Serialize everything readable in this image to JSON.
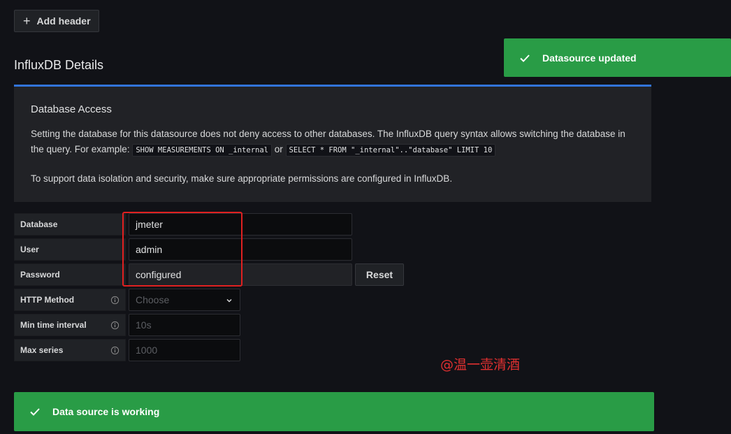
{
  "toolbar": {
    "add_header_label": "Add header"
  },
  "toast": {
    "message": "Datasource updated",
    "color": "#299c46"
  },
  "section": {
    "title": "InfluxDB Details"
  },
  "info": {
    "heading": "Database Access",
    "text_part1": "Setting the database for this datasource does not deny access to other databases. The InfluxDB query syntax allows switching the database in the query. For example: ",
    "code1": "SHOW MEASUREMENTS ON _internal",
    "text_or": " or ",
    "code2": "SELECT * FROM \"_internal\"..\"database\" LIMIT 10",
    "text_part2": "To support data isolation and security, make sure appropriate permissions are configured in InfluxDB.",
    "accent_color": "#3274d9"
  },
  "form": {
    "database": {
      "label": "Database",
      "value": "jmeter"
    },
    "user": {
      "label": "User",
      "value": "admin"
    },
    "password": {
      "label": "Password",
      "value": "configured",
      "reset_label": "Reset"
    },
    "http_method": {
      "label": "HTTP Method",
      "placeholder": "Choose"
    },
    "min_time_interval": {
      "label": "Min time interval",
      "placeholder": "10s"
    },
    "max_series": {
      "label": "Max series",
      "placeholder": "1000"
    }
  },
  "watermark": "@温一壶清酒",
  "status": {
    "message": "Data source is working",
    "color": "#299c46"
  },
  "icons": [
    "plus-icon",
    "check-icon",
    "info-icon",
    "chevron-down-icon"
  ]
}
